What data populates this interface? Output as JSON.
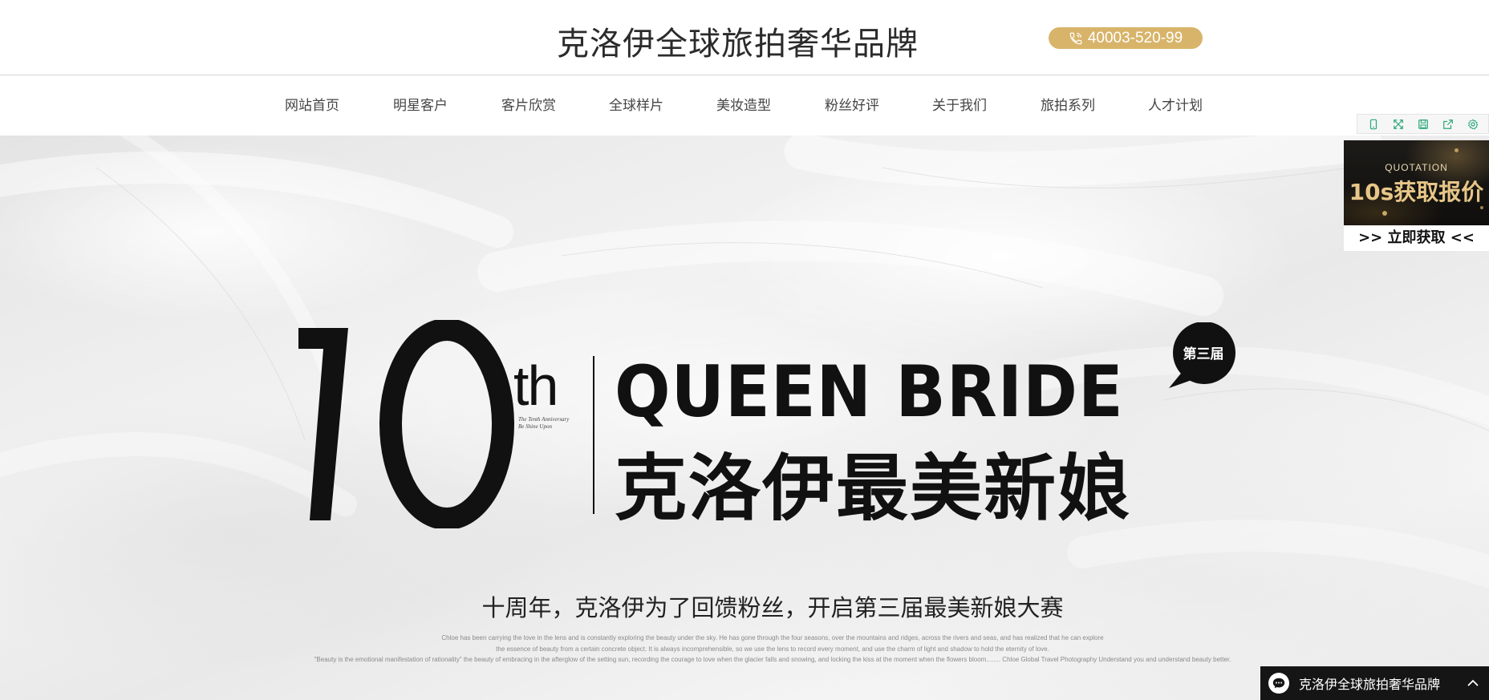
{
  "header": {
    "site_title": "克洛伊全球旅拍奢华品牌",
    "phone": "40003-520-99"
  },
  "nav": {
    "items": [
      {
        "label": "网站首页"
      },
      {
        "label": "明星客户"
      },
      {
        "label": "客片欣赏"
      },
      {
        "label": "全球样片"
      },
      {
        "label": "美妆造型"
      },
      {
        "label": "粉丝好评"
      },
      {
        "label": "关于我们"
      },
      {
        "label": "旅拍系列"
      },
      {
        "label": "人才计划"
      }
    ]
  },
  "hero": {
    "number": "10",
    "suffix": "th",
    "anniversary_line1": "The Tenth Anniversary",
    "anniversary_line2": "Be Shine Upon",
    "title_en": "QUEEN BRIDE",
    "title_cn": "克洛伊最美新娘",
    "badge": "第三届",
    "subtitle": "十周年，克洛伊为了回馈粉丝，开启第三届最美新娘大赛",
    "description": [
      "Chloe has been carrying the love in the lens and is constantly exploring the beauty under the sky. He has gone through the four seasons, over the mountains and ridges, across the rivers and seas, and has realized that he can explore",
      "the essence of beauty from a certain concrete object. It is always incomprehensible, so we use the lens to record every moment, and use the charm of light and shadow to hold the eternity of love.",
      "\"Beauty is the emotional manifestation of rationality\" the beauty of embracing in the afterglow of the setting sun, recording the courage to love when the glacier falls and snowing, and locking the kiss at the moment when the flowers bloom........ Chloe Global Travel Photography Understand you and understand beauty better."
    ]
  },
  "toolbar": {
    "icons": [
      "mobile-icon",
      "fullscreen-icon",
      "save-icon",
      "share-icon",
      "settings-icon"
    ],
    "accent": "#2aa879"
  },
  "quote_widget": {
    "label_en": "QUOTATION",
    "title": "10s获取报价",
    "cta": ">> 立即获取 <<"
  },
  "chat": {
    "label": "克洛伊全球旅拍奢华品牌"
  },
  "colors": {
    "brand_gold": "#d8b46a",
    "text_dark": "#111111"
  }
}
